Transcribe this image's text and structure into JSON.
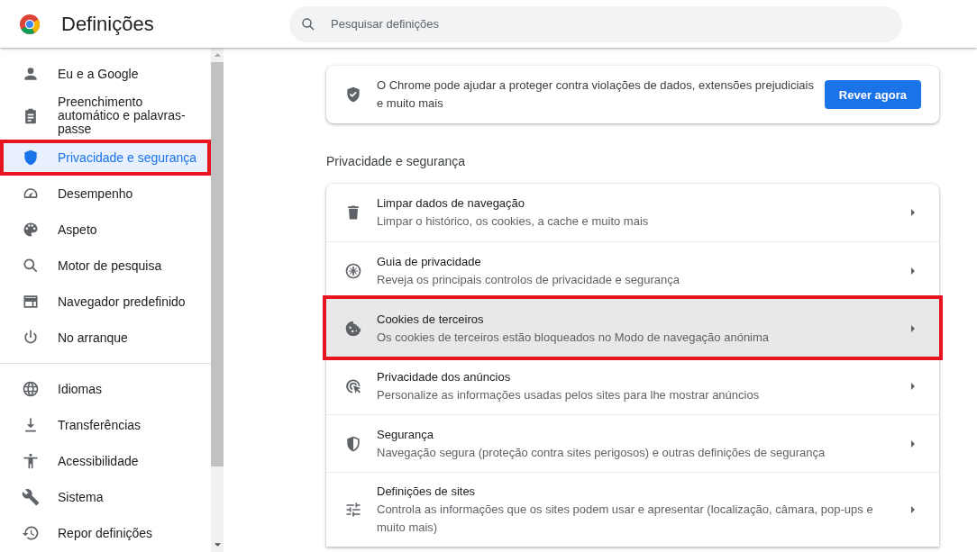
{
  "header": {
    "title": "Definições",
    "search": {
      "placeholder": "Pesquisar definições"
    }
  },
  "sidebar": {
    "groups": [
      [
        {
          "label": "Eu e a Google",
          "selected": false,
          "annotated": false
        },
        {
          "label": "Preenchimento automático e palavras-passe",
          "selected": false,
          "annotated": false
        },
        {
          "label": "Privacidade e segurança",
          "selected": true,
          "annotated": true
        },
        {
          "label": "Desempenho",
          "selected": false,
          "annotated": false
        },
        {
          "label": "Aspeto",
          "selected": false,
          "annotated": false
        },
        {
          "label": "Motor de pesquisa",
          "selected": false,
          "annotated": false
        },
        {
          "label": "Navegador predefinido",
          "selected": false,
          "annotated": false
        },
        {
          "label": "No arranque",
          "selected": false,
          "annotated": false
        }
      ],
      [
        {
          "label": "Idiomas",
          "selected": false,
          "annotated": false
        },
        {
          "label": "Transferências",
          "selected": false,
          "annotated": false
        },
        {
          "label": "Acessibilidade",
          "selected": false,
          "annotated": false
        },
        {
          "label": "Sistema",
          "selected": false,
          "annotated": false
        },
        {
          "label": "Repor definições",
          "selected": false,
          "annotated": false
        }
      ]
    ]
  },
  "safety_card": {
    "text": "O Chrome pode ajudar a proteger contra violações de dados, extensões prejudiciais e muito mais",
    "button": "Rever agora"
  },
  "section": {
    "heading": "Privacidade e segurança",
    "rows": [
      {
        "title": "Limpar dados de navegação",
        "subtitle": "Limpar o histórico, os cookies, a cache e muito mais",
        "highlighted": false,
        "annotated": false
      },
      {
        "title": "Guia de privacidade",
        "subtitle": "Reveja os principais controlos de privacidade e segurança",
        "highlighted": false,
        "annotated": false
      },
      {
        "title": "Cookies de terceiros",
        "subtitle": "Os cookies de terceiros estão bloqueados no Modo de navegação anónima",
        "highlighted": true,
        "annotated": true
      },
      {
        "title": "Privacidade dos anúncios",
        "subtitle": "Personalize as informações usadas pelos sites para lhe mostrar anúncios",
        "highlighted": false,
        "annotated": false
      },
      {
        "title": "Segurança",
        "subtitle": "Navegação segura (proteção contra sites perigosos) e outras definições de segurança",
        "highlighted": false,
        "annotated": false
      },
      {
        "title": "Definições de sites",
        "subtitle": "Controla as informações que os sites podem usar e apresentar (localização, câmara, pop-ups e muito mais)",
        "highlighted": false,
        "annotated": false
      }
    ]
  }
}
